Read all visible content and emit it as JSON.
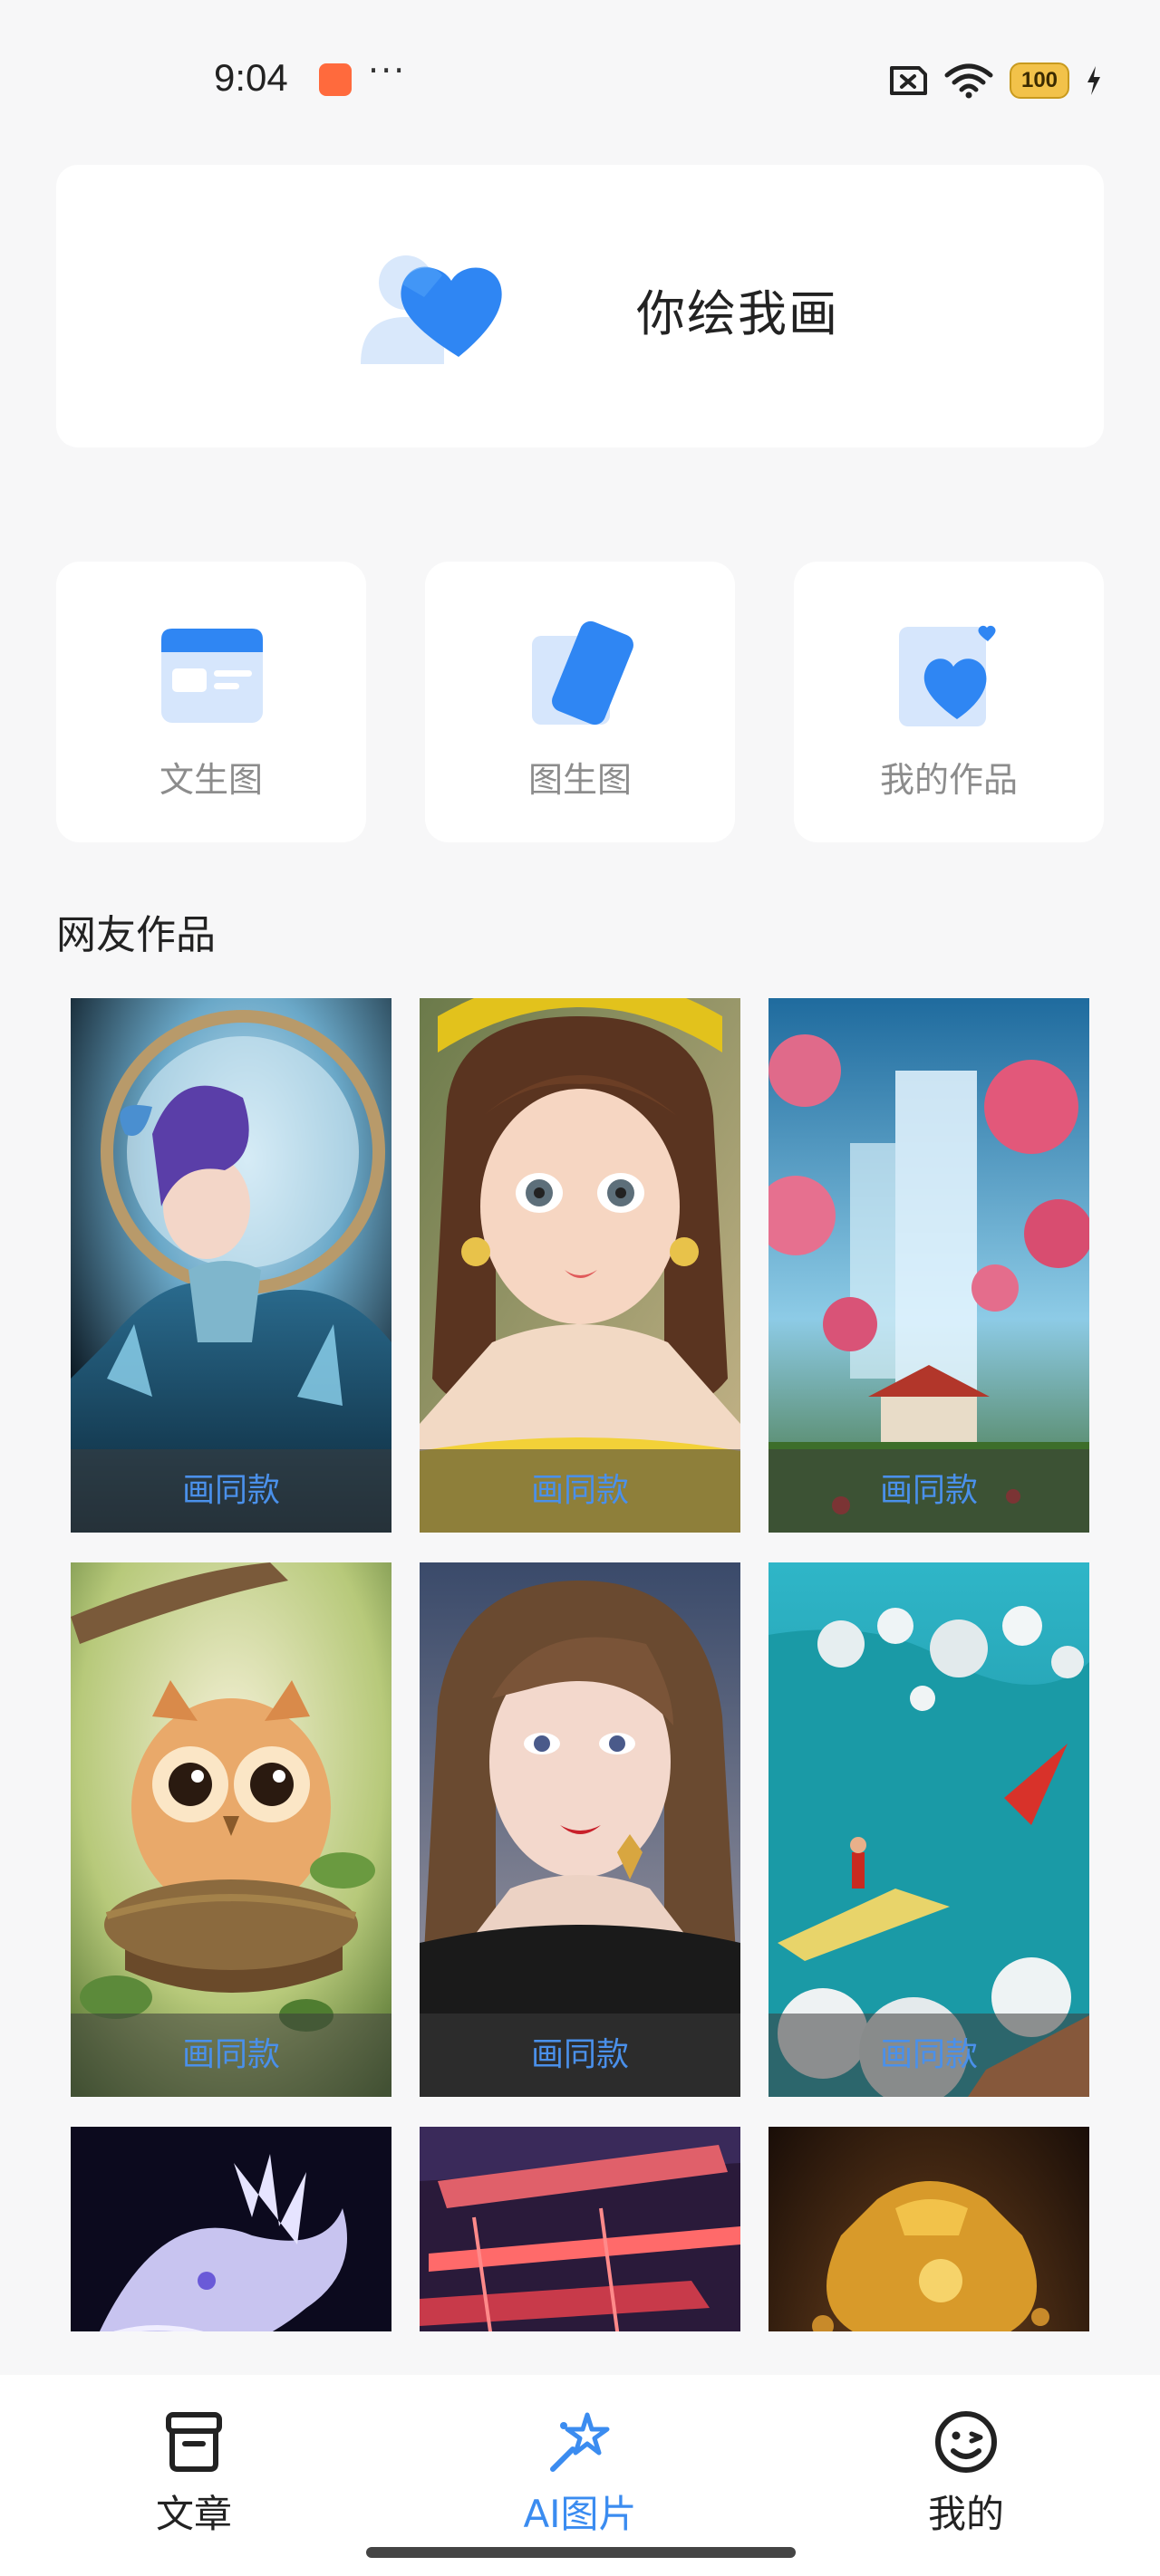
{
  "status_bar": {
    "time": "9:04",
    "dots": "···",
    "battery": "100"
  },
  "hero": {
    "title": "你绘我画",
    "icon": "heart-people-icon"
  },
  "features": [
    {
      "label": "文生图",
      "icon": "text-to-image-icon"
    },
    {
      "label": "图生图",
      "icon": "image-to-image-icon"
    },
    {
      "label": "我的作品",
      "icon": "my-works-icon"
    }
  ],
  "section": {
    "title": "网友作品"
  },
  "gallery": {
    "action_label": "画同款",
    "items": [
      {
        "name": "gallery-fantasy-woman"
      },
      {
        "name": "gallery-doll-girl"
      },
      {
        "name": "gallery-waterfall-temple"
      },
      {
        "name": "gallery-owl-nest"
      },
      {
        "name": "gallery-portrait-woman"
      },
      {
        "name": "gallery-surf-wave"
      },
      {
        "name": "gallery-crystal-dragon"
      },
      {
        "name": "gallery-neon-building"
      },
      {
        "name": "gallery-gold-bag"
      }
    ]
  },
  "nav": {
    "items": [
      {
        "label": "文章",
        "icon": "article-icon"
      },
      {
        "label": "AI图片",
        "icon": "ai-image-icon",
        "active": true
      },
      {
        "label": "我的",
        "icon": "smiley-icon"
      }
    ]
  },
  "colors": {
    "accent": "#3b8cf0",
    "background": "#f7f7f8",
    "action_text": "#4a90ea"
  }
}
